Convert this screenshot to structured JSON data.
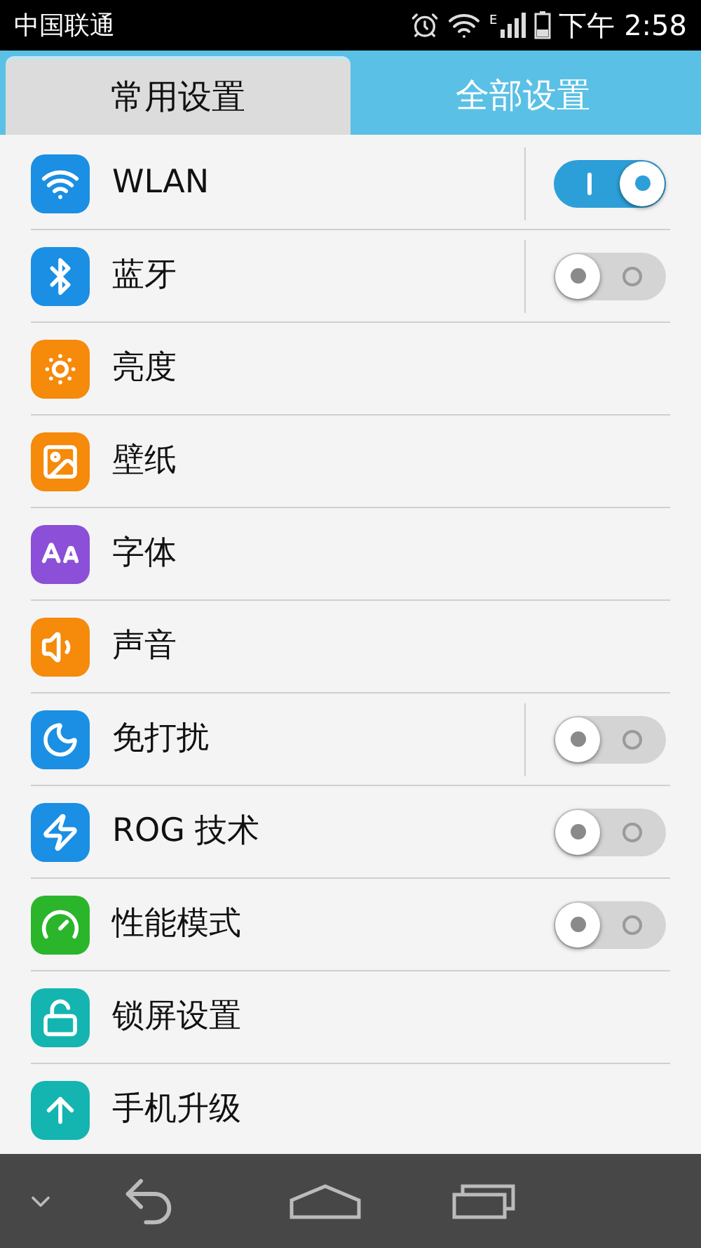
{
  "status_bar": {
    "carrier": "中国联通",
    "network": "E",
    "time": "下午 2:58"
  },
  "tabs": [
    {
      "label": "常用设置",
      "selected": true
    },
    {
      "label": "全部设置",
      "selected": false
    }
  ],
  "settings": [
    {
      "label": "WLAN",
      "color": "#1a8fe3",
      "kind": "toggle",
      "on": true,
      "separated": true
    },
    {
      "label": "蓝牙",
      "color": "#1a8fe3",
      "kind": "toggle",
      "on": false,
      "separated": true
    },
    {
      "label": "亮度",
      "color": "#f58a0b",
      "kind": "link"
    },
    {
      "label": "壁纸",
      "color": "#f58a0b",
      "kind": "link"
    },
    {
      "label": "字体",
      "color": "#8b4fd8",
      "kind": "link"
    },
    {
      "label": "声音",
      "color": "#f58a0b",
      "kind": "link"
    },
    {
      "label": "免打扰",
      "color": "#1a8fe3",
      "kind": "toggle",
      "on": false,
      "separated": true
    },
    {
      "label": "ROG 技术",
      "color": "#1a8fe3",
      "kind": "toggle",
      "on": false,
      "separated": false
    },
    {
      "label": "性能模式",
      "color": "#2bb52b",
      "kind": "toggle",
      "on": false,
      "separated": false
    },
    {
      "label": "锁屏设置",
      "color": "#14b5b0",
      "kind": "link"
    },
    {
      "label": "手机升级",
      "color": "#14b5b0",
      "kind": "link"
    }
  ]
}
